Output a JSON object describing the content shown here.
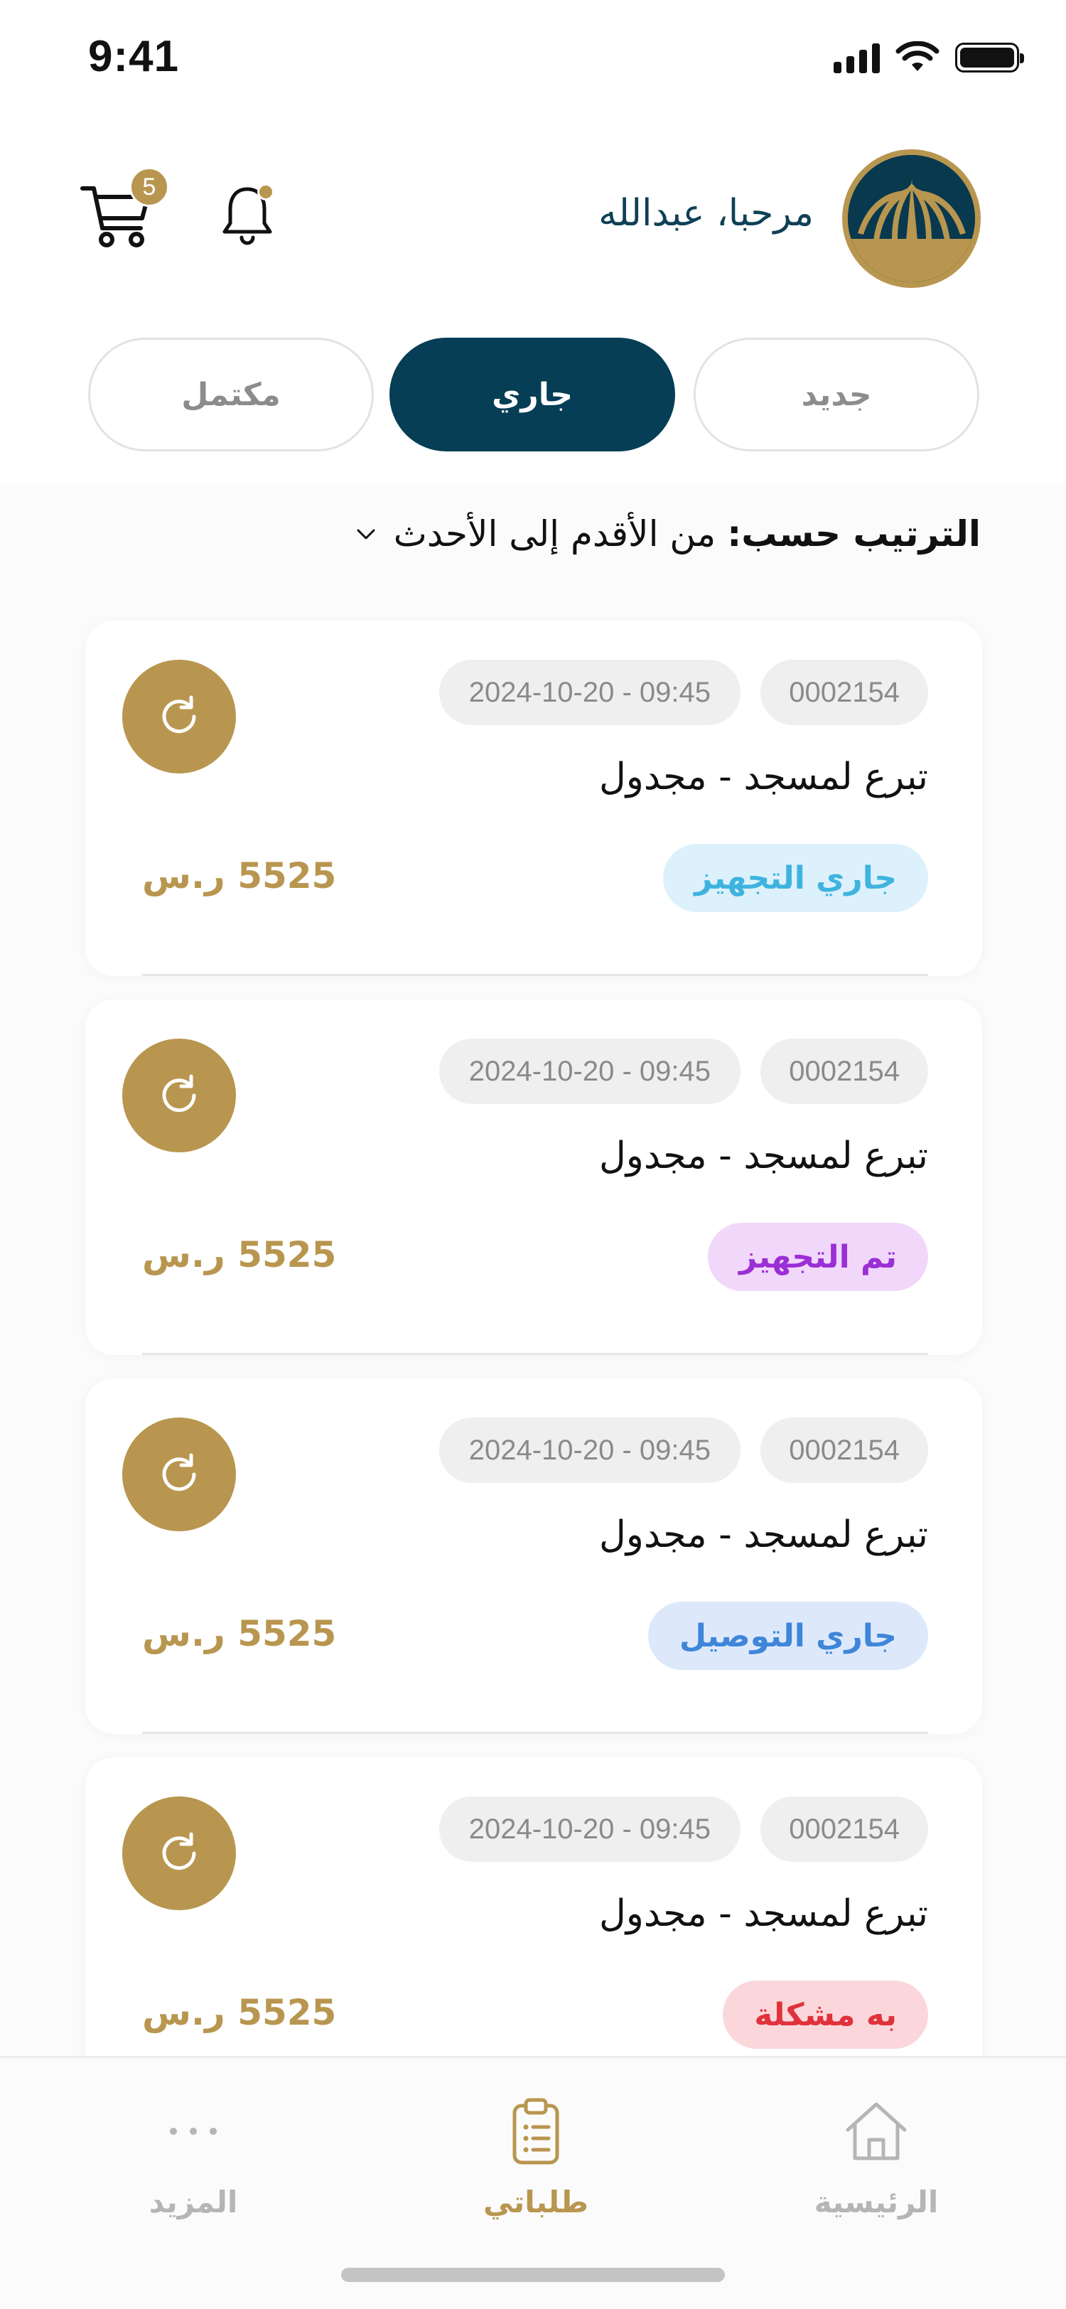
{
  "status_bar": {
    "time": "9:41"
  },
  "header": {
    "greeting": "مرحبا، عبدالله",
    "cart_count": "5"
  },
  "tabs": [
    {
      "label": "مكتمل",
      "active": false
    },
    {
      "label": "جاري",
      "active": true
    },
    {
      "label": "جديد",
      "active": false
    }
  ],
  "sort": {
    "label": "الترتيب حسب:",
    "value": "من الأقدم إلى الأحدث"
  },
  "orders": [
    {
      "id": "0002154",
      "datetime": "2024-10-20 - 09:45",
      "title": "تبرع لمسجد - مجدول",
      "status": "جاري التجهيز",
      "status_bg": "#dcf1fb",
      "status_color": "#3fb3df",
      "price": "5525 ر.س"
    },
    {
      "id": "0002154",
      "datetime": "2024-10-20 - 09:45",
      "title": "تبرع لمسجد - مجدول",
      "status": "تم التجهيز",
      "status_bg": "#f1d8fb",
      "status_color": "#9b2fd6",
      "price": "5525 ر.س"
    },
    {
      "id": "0002154",
      "datetime": "2024-10-20 - 09:45",
      "title": "تبرع لمسجد - مجدول",
      "status": "جاري التوصيل",
      "status_bg": "#dde9fb",
      "status_color": "#3f86d9",
      "price": "5525 ر.س"
    },
    {
      "id": "0002154",
      "datetime": "2024-10-20 - 09:45",
      "title": "تبرع لمسجد - مجدول",
      "status": "به مشكلة",
      "status_bg": "#fbd7db",
      "status_color": "#e0323b",
      "price": "5525 ر.س"
    }
  ],
  "nav": {
    "more": "المزيد",
    "orders": "طلباتي",
    "home": "الرئيسية"
  },
  "colors": {
    "primary": "#063e56",
    "accent": "#b8964f"
  },
  "icons": [
    "cart-icon",
    "bell-icon",
    "refresh-icon",
    "chevron-down-icon",
    "more-dots-icon",
    "clipboard-icon",
    "home-icon",
    "signal-icon",
    "wifi-icon",
    "battery-icon"
  ]
}
